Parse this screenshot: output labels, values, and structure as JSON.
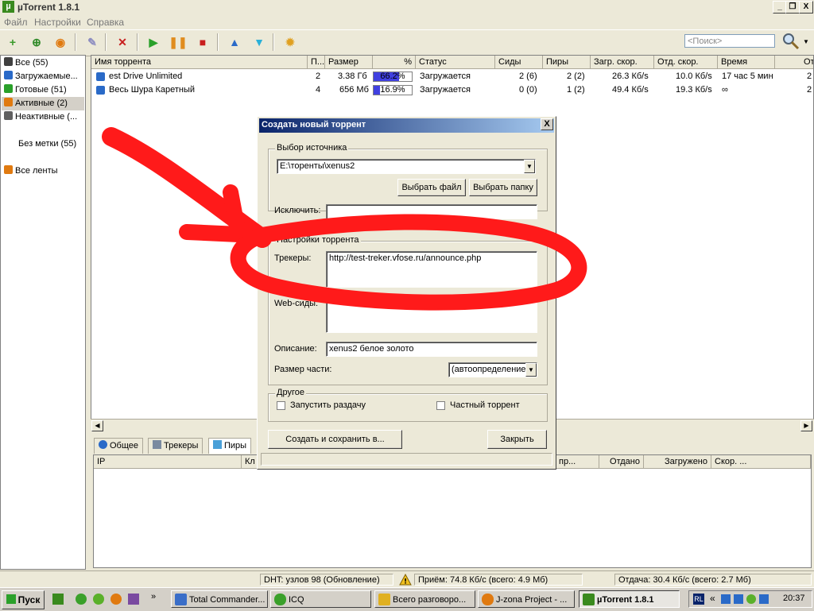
{
  "window": {
    "title": "µTorrent 1.8.1",
    "min": "_",
    "max": "❐",
    "close": "X"
  },
  "menu": [
    {
      "label": "Файл"
    },
    {
      "label": "Настройки"
    },
    {
      "label": "Справка"
    }
  ],
  "toolbar": {
    "buttons": [
      {
        "name": "add-torrent-icon",
        "glyph": "+",
        "color": "#3a9a2a"
      },
      {
        "name": "add-url-icon",
        "glyph": "⊕",
        "color": "#2f8a28"
      },
      {
        "name": "rss-icon",
        "glyph": "◉",
        "color": "#e07a10"
      },
      {
        "name": "create-torrent-icon",
        "glyph": "✎",
        "color": "#8c8cc0"
      },
      {
        "name": "remove-icon",
        "glyph": "✕",
        "color": "#c81e1e"
      },
      {
        "name": "start-icon",
        "glyph": "▶",
        "color": "#2aa02a"
      },
      {
        "name": "pause-icon",
        "glyph": "❚❚",
        "color": "#e08c1e"
      },
      {
        "name": "stop-icon",
        "glyph": "■",
        "color": "#c81e1e"
      },
      {
        "name": "move-up-icon",
        "glyph": "▲",
        "color": "#2a6ac8"
      },
      {
        "name": "move-down-icon",
        "glyph": "▼",
        "color": "#2ab0d8"
      },
      {
        "name": "preferences-icon",
        "glyph": "✹",
        "color": "#e0a020"
      }
    ],
    "search_placeholder": "<Поиск>"
  },
  "sidebar": {
    "items": [
      {
        "label": "Все (55)",
        "color": "#404040"
      },
      {
        "label": "Загружаемые...",
        "color": "#2a6ac8"
      },
      {
        "label": "Готовые (51)",
        "color": "#2aa02a"
      },
      {
        "label": "Активные (2)",
        "color": "#e07a10"
      },
      {
        "label": "Неактивные (...",
        "color": "#606060"
      }
    ],
    "labels_item": "Без метки (55)",
    "feeds_item": "Все ленты"
  },
  "columns": [
    "Имя торрента",
    "П...",
    "Размер",
    "%",
    "Статус",
    "Сиды",
    "Пиры",
    "Загр. скор.",
    "Отд. скор.",
    "Время",
    "От"
  ],
  "torrents": [
    {
      "name": "est Drive Unlimited",
      "pos": "2",
      "size": "3.38 Гб",
      "percent": "66.2%",
      "progress": 0.662,
      "status": "Загружается",
      "seeds": "2 (6)",
      "peers": "2 (2)",
      "down": "26.3 Кб/s",
      "up": "10.0 Кб/s",
      "eta": "17 час 5 мин",
      "ratio": "2"
    },
    {
      "name": "Весь Шура Каретный",
      "pos": "4",
      "size": "656 Мб",
      "percent": "16.9%",
      "progress": 0.169,
      "status": "Загружается",
      "seeds": "0 (0)",
      "peers": "1 (2)",
      "down": "49.4 Кб/s",
      "up": "19.3 Кб/s",
      "eta": "∞",
      "ratio": "2"
    }
  ],
  "bottom_tabs": [
    {
      "label": "Общее"
    },
    {
      "label": "Трекеры"
    },
    {
      "label": "Пиры"
    }
  ],
  "peer_columns": [
    "IP",
    "Кл",
    "пр...",
    "Отдано",
    "Загружено",
    "Скор. ..."
  ],
  "status": {
    "dht": "DHT: узлов 98  (Обновление)",
    "receive": "Приём: 74.8 Кб/с (всего: 4.9 Мб)",
    "send": "Отдача: 30.4 Кб/с (всего: 2.7 Мб)"
  },
  "dialog": {
    "title": "Создать новый торрент",
    "close": "X",
    "source_group": "Выбор источника",
    "source_value": "E:\\торенты\\xenus2",
    "select_file": "Выбрать файл",
    "select_folder": "Выбрать папку",
    "exclude_label": "Исключить:",
    "exclude_value": "",
    "settings_group": "Настройки торрента",
    "trackers_label": "Трекеры:",
    "trackers_value": "http://test-treker.vfose.ru/announce.php",
    "webseeds_label": "Web-сиды:",
    "webseeds_value": "",
    "description_label": "Описание:",
    "description_value": "xenus2 белое золото",
    "piece_size_label": "Размер части:",
    "piece_size_value": "(автоопределение)",
    "other_group": "Другое",
    "start_seeding": "Запустить раздачу",
    "private_torrent": "Частный торрент",
    "create_button": "Создать и сохранить в...",
    "close_button": "Закрыть"
  },
  "taskbar": {
    "start": "Пуск",
    "tasks": [
      {
        "label": "Total Commander...",
        "color": "#3a6ec8"
      },
      {
        "label": "ICQ",
        "color": "#3aa02a"
      },
      {
        "label": "Всего разговоро...",
        "color": "#e0b020"
      },
      {
        "label": "J-zona Project - ...",
        "color": "#e07a10"
      },
      {
        "label": "µTorrent 1.8.1",
        "color": "#3a8a1e"
      }
    ],
    "lang": "RL",
    "clock": "20:37"
  },
  "annotation_color": "#ff1a1a"
}
